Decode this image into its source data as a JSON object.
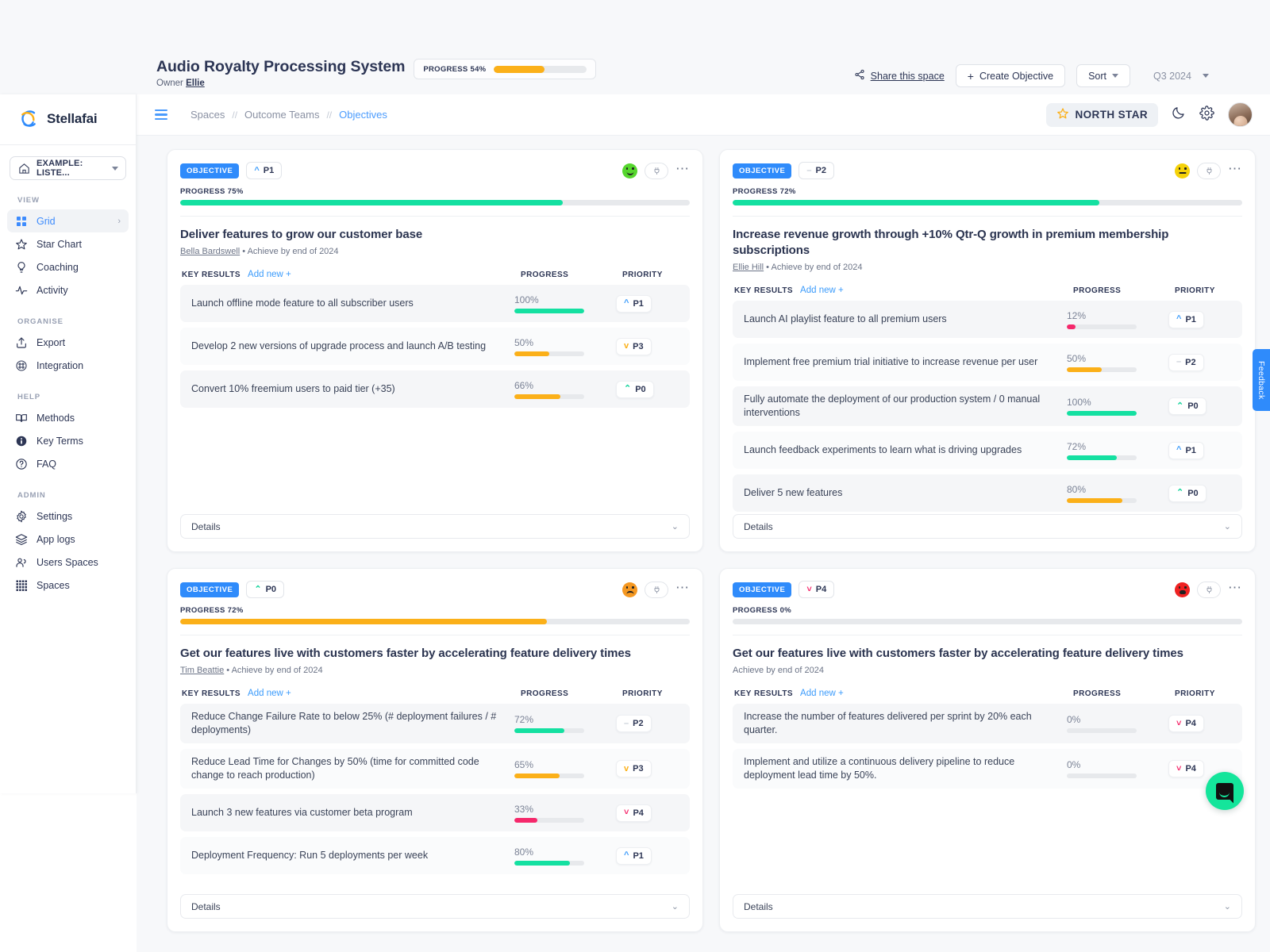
{
  "space": {
    "title": "Audio Royalty Processing System",
    "owner_label": "Owner",
    "owner_name": "Ellie",
    "progress_label": "PROGRESS 54%",
    "progress_value": 54,
    "share_label": "Share this space",
    "create_objective_label": "Create Objective",
    "sort_label": "Sort",
    "quarter_label": "Q3 2024"
  },
  "sidebar": {
    "brand": "Stellafai",
    "space_selector": "EXAMPLE: LISTE...",
    "groups": [
      {
        "label": "VIEW",
        "items": [
          {
            "label": "Grid",
            "icon": "grid-icon",
            "active": true
          },
          {
            "label": "Star Chart",
            "icon": "star-icon",
            "active": false
          },
          {
            "label": "Coaching",
            "icon": "bulb-icon",
            "active": false
          },
          {
            "label": "Activity",
            "icon": "activity-icon",
            "active": false
          }
        ]
      },
      {
        "label": "ORGANISE",
        "items": [
          {
            "label": "Export",
            "icon": "export-icon",
            "active": false
          },
          {
            "label": "Integration",
            "icon": "integration-icon",
            "active": false
          }
        ]
      },
      {
        "label": "HELP",
        "items": [
          {
            "label": "Methods",
            "icon": "book-icon",
            "active": false
          },
          {
            "label": "Key Terms",
            "icon": "info-icon",
            "active": false
          },
          {
            "label": "FAQ",
            "icon": "question-icon",
            "active": false
          }
        ]
      },
      {
        "label": "ADMIN",
        "items": [
          {
            "label": "Settings",
            "icon": "gear-icon",
            "active": false
          },
          {
            "label": "App logs",
            "icon": "layers-icon",
            "active": false
          },
          {
            "label": "Users Spaces",
            "icon": "users-icon",
            "active": false
          },
          {
            "label": "Spaces",
            "icon": "spaces-grid-icon",
            "active": false
          }
        ]
      }
    ]
  },
  "topbar": {
    "breadcrumb": [
      "Spaces",
      "Outcome Teams",
      "Objectives"
    ],
    "breadcrumb_separator": "//",
    "north_star_label": "NORTH STAR"
  },
  "common": {
    "objective_tag": "OBJECTIVE",
    "key_results_label": "KEY RESULTS",
    "add_new_label": "Add new +",
    "progress_col": "PROGRESS",
    "priority_col": "PRIORITY",
    "details_label": "Details"
  },
  "side_widgets": {
    "feedback_label": "Feedback"
  },
  "colors": {
    "green": "#14e0a1",
    "orange": "#fbb019",
    "pink": "#f5286b",
    "blue": "#2f8bfb",
    "track": "#e7e9ec"
  },
  "cards": [
    {
      "priority": "P1",
      "priority_icon": "^",
      "priority_class": "p1",
      "mood": "happy",
      "progress_label": "PROGRESS 75%",
      "progress_value": 75,
      "progress_color": "#14e0a1",
      "title": "Deliver features to grow our customer base",
      "owner": "Bella Bardswell",
      "due": "Achieve by end of 2024",
      "key_results": [
        {
          "name": "Launch offline mode feature to all subscriber users",
          "pct": "100%",
          "value": 100,
          "color": "#14e0a1",
          "priority": "P1",
          "priority_icon": "^",
          "priority_class": "p1"
        },
        {
          "name": "Develop 2 new versions of upgrade process and launch A/B testing",
          "pct": "50%",
          "value": 50,
          "color": "#fbb019",
          "priority": "P3",
          "priority_icon": "v",
          "priority_class": "p3"
        },
        {
          "name": "Convert 10% freemium users to paid tier (+35)",
          "pct": "66%",
          "value": 66,
          "color": "#fbb019",
          "priority": "P0",
          "priority_icon": "⌃",
          "priority_class": "p0"
        }
      ]
    },
    {
      "priority": "P2",
      "priority_icon": "–",
      "priority_class": "p2",
      "mood": "neutral",
      "progress_label": "PROGRESS 72%",
      "progress_value": 72,
      "progress_color": "#14e0a1",
      "title": "Increase revenue growth through +10% Qtr-Q growth in premium membership subscriptions",
      "owner": "Ellie Hill",
      "due": "Achieve by end of 2024",
      "key_results": [
        {
          "name": "Launch AI playlist feature to all premium users",
          "pct": "12%",
          "value": 12,
          "color": "#f5286b",
          "priority": "P1",
          "priority_icon": "^",
          "priority_class": "p1"
        },
        {
          "name": "Implement free premium trial initiative to increase revenue per user",
          "pct": "50%",
          "value": 50,
          "color": "#fbb019",
          "priority": "P2",
          "priority_icon": "–",
          "priority_class": "p2"
        },
        {
          "name": "Fully automate the deployment of our production system / 0 manual interventions",
          "pct": "100%",
          "value": 100,
          "color": "#14e0a1",
          "priority": "P0",
          "priority_icon": "⌃",
          "priority_class": "p0"
        },
        {
          "name": "Launch feedback experiments to learn what is driving upgrades",
          "pct": "72%",
          "value": 72,
          "color": "#14e0a1",
          "priority": "P1",
          "priority_icon": "^",
          "priority_class": "p1"
        },
        {
          "name": "Deliver 5 new features",
          "pct": "80%",
          "value": 80,
          "color": "#fbb019",
          "priority": "P0",
          "priority_icon": "⌃",
          "priority_class": "p0"
        }
      ]
    },
    {
      "priority": "P0",
      "priority_icon": "⌃",
      "priority_class": "p0",
      "mood": "sad",
      "progress_label": "PROGRESS 72%",
      "progress_value": 72,
      "progress_color": "#fbb019",
      "title": "Get our features live with customers faster by accelerating feature delivery times",
      "owner": "Tim Beattie",
      "due": "Achieve by end of 2024",
      "key_results": [
        {
          "name": "Reduce Change Failure Rate to below 25% (# deployment failures / # deployments)",
          "pct": "72%",
          "value": 72,
          "color": "#14e0a1",
          "priority": "P2",
          "priority_icon": "–",
          "priority_class": "p2"
        },
        {
          "name": "Reduce Lead Time for Changes by 50% (time for committed code change to reach production)",
          "pct": "65%",
          "value": 65,
          "color": "#fbb019",
          "priority": "P3",
          "priority_icon": "v",
          "priority_class": "p3"
        },
        {
          "name": "Launch 3 new features via customer beta program",
          "pct": "33%",
          "value": 33,
          "color": "#f5286b",
          "priority": "P4",
          "priority_icon": "˅",
          "priority_class": "p4"
        },
        {
          "name": "Deployment Frequency: Run 5 deployments per week",
          "pct": "80%",
          "value": 80,
          "color": "#14e0a1",
          "priority": "P1",
          "priority_icon": "^",
          "priority_class": "p1"
        }
      ]
    },
    {
      "priority": "P4",
      "priority_icon": "˅",
      "priority_class": "p4",
      "mood": "angry",
      "progress_label": "PROGRESS 0%",
      "progress_value": 0,
      "progress_color": "#14e0a1",
      "title": "Get our features live with customers faster by accelerating feature delivery times",
      "owner": "",
      "due": "Achieve by end of 2024",
      "key_results": [
        {
          "name": "Increase the number of features delivered per sprint by 20% each quarter.",
          "pct": "0%",
          "value": 0,
          "color": "#14e0a1",
          "priority": "P4",
          "priority_icon": "˅",
          "priority_class": "p4"
        },
        {
          "name": "Implement and utilize a continuous delivery pipeline to reduce deployment lead time by 50%.",
          "pct": "0%",
          "value": 0,
          "color": "#14e0a1",
          "priority": "P4",
          "priority_icon": "˅",
          "priority_class": "p4"
        }
      ]
    }
  ]
}
